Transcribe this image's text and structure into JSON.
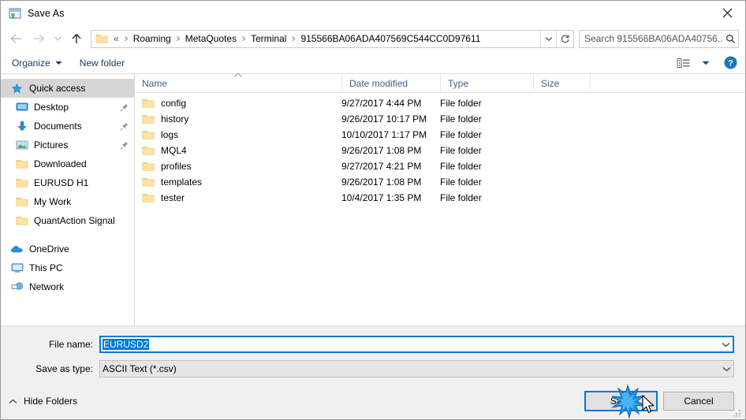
{
  "window": {
    "title": "Save As",
    "app_icon": "save-as-icon",
    "close_icon": "close-icon"
  },
  "navbar": {
    "back_icon": "back-arrow-icon",
    "forward_icon": "forward-arrow-icon",
    "recent_icon": "recent-locations-icon",
    "up_icon": "up-arrow-icon",
    "folder_icon": "folder-icon",
    "breadcrumbs": [
      "«",
      "Roaming",
      "MetaQuotes",
      "Terminal",
      "915566BA06ADA407569C544CC0D97611"
    ],
    "dropdown_icon": "chevron-down-icon",
    "refresh_icon": "refresh-icon",
    "search_placeholder": "Search 915566BA06ADA40756...",
    "search_icon": "search-icon"
  },
  "toolbar": {
    "organize_label": "Organize",
    "organize_caret": "caret-down-icon",
    "new_folder_label": "New folder",
    "view_icon": "view-layout-icon",
    "view_caret": "caret-down-icon",
    "help_icon": "help-icon"
  },
  "sidebar": {
    "quick_access": {
      "label": "Quick access",
      "icon": "star-pin-icon",
      "selected": true
    },
    "quick_items": [
      {
        "label": "Desktop",
        "icon": "desktop-icon",
        "pinned": true
      },
      {
        "label": "Documents",
        "icon": "documents-download-icon",
        "pinned": true
      },
      {
        "label": "Pictures",
        "icon": "pictures-icon",
        "pinned": true
      },
      {
        "label": "Downloaded",
        "icon": "folder-icon",
        "pinned": false
      },
      {
        "label": "EURUSD H1",
        "icon": "folder-icon",
        "pinned": false
      },
      {
        "label": "My Work",
        "icon": "folder-icon",
        "pinned": false
      },
      {
        "label": "QuantAction Signal",
        "icon": "folder-icon",
        "pinned": false
      }
    ],
    "roots": [
      {
        "label": "OneDrive",
        "icon": "onedrive-cloud-icon"
      },
      {
        "label": "This PC",
        "icon": "this-pc-icon"
      },
      {
        "label": "Network",
        "icon": "network-icon"
      }
    ]
  },
  "filelist": {
    "columns": [
      "Name",
      "Date modified",
      "Type",
      "Size"
    ],
    "sort_column": "Name",
    "sort_direction": "ascending",
    "rows": [
      {
        "name": "config",
        "date": "9/27/2017 4:44 PM",
        "type": "File folder",
        "size": ""
      },
      {
        "name": "history",
        "date": "9/26/2017 10:17 PM",
        "type": "File folder",
        "size": ""
      },
      {
        "name": "logs",
        "date": "10/10/2017 1:17 PM",
        "type": "File folder",
        "size": ""
      },
      {
        "name": "MQL4",
        "date": "9/26/2017 1:08 PM",
        "type": "File folder",
        "size": ""
      },
      {
        "name": "profiles",
        "date": "9/27/2017 4:21 PM",
        "type": "File folder",
        "size": ""
      },
      {
        "name": "templates",
        "date": "9/26/2017 1:08 PM",
        "type": "File folder",
        "size": ""
      },
      {
        "name": "tester",
        "date": "10/4/2017 1:35 PM",
        "type": "File folder",
        "size": ""
      }
    ]
  },
  "form": {
    "filename_label": "File name:",
    "filename_value": "EURUSD2",
    "filetype_label": "Save as type:",
    "filetype_value": "ASCII Text (*.csv)",
    "dropdown_icon": "chevron-down-icon"
  },
  "footer": {
    "hide_folders_label": "Hide Folders",
    "hide_folders_icon": "caret-up-icon",
    "save_label": "Save",
    "cancel_label": "Cancel",
    "resize_grip": "resize-grip-icon",
    "cursor": "mouse-cursor",
    "click_indicator": "click-burst"
  },
  "colors": {
    "accent": "#0078d7",
    "folder_yellow": "#fcd77a",
    "header_text": "#41618a",
    "chrome_bg": "#f0f0f0"
  }
}
